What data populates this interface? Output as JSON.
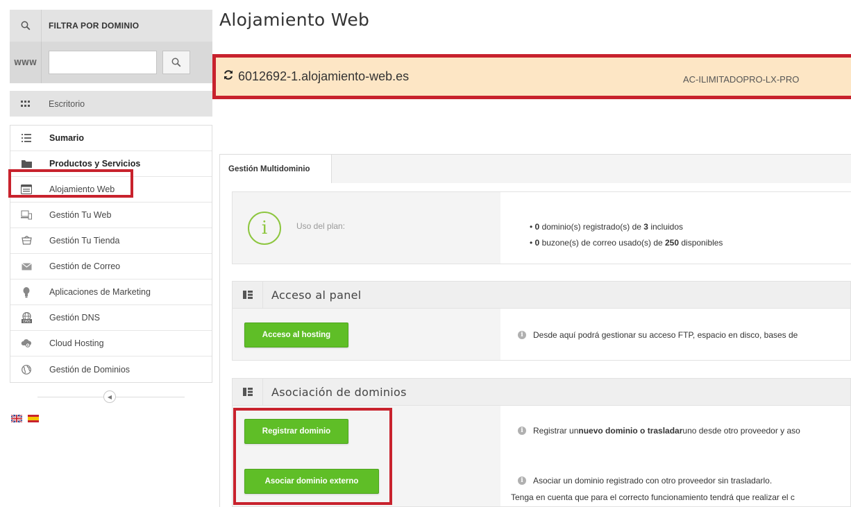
{
  "sidebar": {
    "filter_title": "FILTRA POR DOMINIO",
    "www_label": "WWW",
    "search_placeholder": "",
    "search_value": "",
    "desktop_label": "Escritorio",
    "items": [
      {
        "label": "Sumario",
        "icon": "list-icon",
        "bold": true
      },
      {
        "label": "Productos y Servicios",
        "icon": "folder-icon",
        "bold": true
      },
      {
        "label": "Alojamiento Web",
        "icon": "hosting-icon",
        "bold": false
      },
      {
        "label": "Gestión Tu Web",
        "icon": "devices-icon",
        "bold": false
      },
      {
        "label": "Gestión Tu Tienda",
        "icon": "cart-icon",
        "bold": false
      },
      {
        "label": "Gestión de Correo",
        "icon": "mail-icon",
        "bold": false
      },
      {
        "label": "Aplicaciones de Marketing",
        "icon": "bulb-icon",
        "bold": false
      },
      {
        "label": "Gestión DNS",
        "icon": "dns-icon",
        "bold": false
      },
      {
        "label": "Cloud Hosting",
        "icon": "cloud-icon",
        "bold": false
      },
      {
        "label": "Gestión de Dominios",
        "icon": "globe-icon",
        "bold": false
      }
    ],
    "languages": [
      "English",
      "Español"
    ]
  },
  "main": {
    "title": "Alojamiento Web",
    "domain": "6012692-1.alojamiento-web.es",
    "plan_code": "AC-ILIMITADOPRO-LX-PRO",
    "tab_label": "Gestión Multidominio",
    "plan": {
      "label": "Uso del plan:",
      "domains_used": "0",
      "domains_text_1": " dominio(s) registrado(s) de ",
      "domains_included": "3",
      "domains_text_2": " incluidos",
      "mailboxes_used": "0",
      "mailboxes_text_1": " buzone(s) de correo usado(s) de ",
      "mailboxes_available": "250",
      "mailboxes_text_2": " disponibles"
    },
    "panel_section": {
      "title": "Acceso al panel",
      "button": "Acceso al hosting",
      "note": "Desde aquí podrá gestionar su acceso FTP, espacio en disco, bases de"
    },
    "domains_section": {
      "title": "Asociación de dominios",
      "register_button": "Registrar dominio",
      "register_note_1": "Registrar un ",
      "register_note_bold": "nuevo dominio o trasladar",
      "register_note_2": " uno desde otro proveedor y aso",
      "external_button": "Asociar dominio externo",
      "external_note": "Asociar un dominio registrado con otro proveedor sin trasladarlo.",
      "external_note_2": "Tenga en cuenta que para el correcto funcionamiento tendrá que realizar el c"
    }
  },
  "colors": {
    "highlight_red": "#c8222d",
    "domain_bar_bg": "#fde6c5",
    "button_green": "#5fbe27",
    "info_green": "#8dc63f"
  }
}
